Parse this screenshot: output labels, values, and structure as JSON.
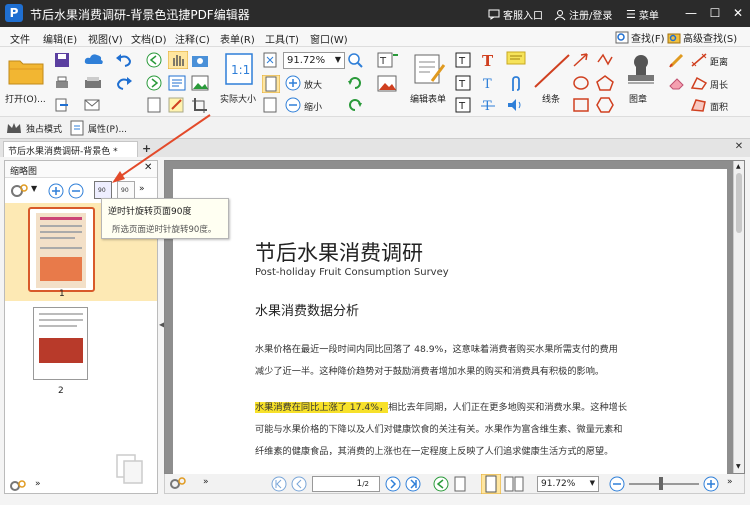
{
  "title_bar": {
    "title": "节后水果消费调研-背景色迅捷PDF编辑器",
    "logo_letter": "P",
    "support": "客服入口",
    "login": "注册/登录",
    "menu": "菜单"
  },
  "menu": [
    "文件",
    "编辑(E)",
    "视图(V)",
    "文档(D)",
    "注释(C)",
    "表单(R)",
    "工具(T)",
    "窗口(W)"
  ],
  "search": {
    "find": "查找(F)",
    "advanced": "高级查找(S)"
  },
  "ribbon": {
    "open": "打开(O)...",
    "zoom_value": "91.72%",
    "actual_size": "实际大小",
    "zoom_in": "放大",
    "zoom_out": "缩小",
    "edit_form": "编辑表单",
    "line": "线条",
    "stamp": "图章",
    "distance": "距离",
    "perimeter": "周长",
    "area": "面积"
  },
  "subbar": {
    "exclusive": "独占模式",
    "properties": "属性(P)..."
  },
  "tab": {
    "label": "节后水果消费调研-背景色 *"
  },
  "panel": {
    "title": "缩略图",
    "page1": "1",
    "page2": "2",
    "rot_label": "90"
  },
  "tooltip": {
    "title": "逆时针旋转页面90度",
    "desc": "所选页面逆时针旋转90度。"
  },
  "document": {
    "heading": "节后水果消费调研",
    "subheading": "Post-holiday Fruit Consumption Survey",
    "section": "水果消费数据分析",
    "para1_line1": "水果价格在最近一段时间内同比回落了 48.9%，这意味着消费者购买水果所需支付的费用",
    "para1_line2": "减少了近一半。这种降价趋势对于鼓励消费者增加水果的购买和消费具有积极的影响。",
    "highlight": "水果消费在同比上涨了 17.4%，",
    "para2_line1_rest": "相比去年同期，人们正在更多地购买和消费水果。这种增长",
    "para2_line2": "可能与水果价格的下降以及人们对健康饮食的关注有关。水果作为富含维生素、微量元素和",
    "para2_line3": "纤维素的健康食品，其消费的上涨也在一定程度上反映了人们追求健康生活方式的愿望。"
  },
  "status": {
    "page_input": "1",
    "page_total": "/2",
    "zoom_value": "91.72%"
  },
  "colors": {
    "titlebar": "#2b2b2b",
    "accent": "#e34a2a",
    "highlight": "#f7e12a",
    "selection": "#ffd866"
  }
}
